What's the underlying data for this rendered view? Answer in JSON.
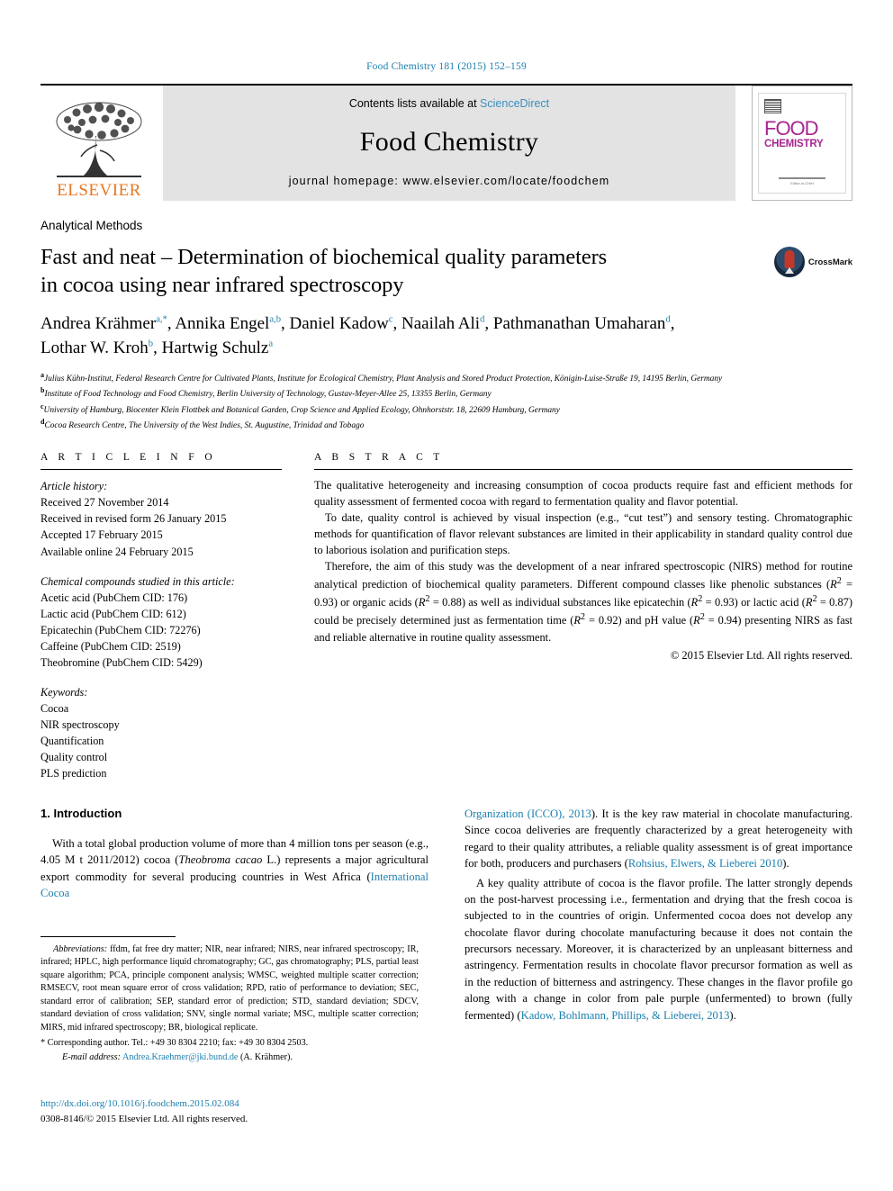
{
  "running_head": "Food Chemistry 181 (2015) 152–159",
  "masthead": {
    "publisher": "ELSEVIER",
    "contents_prefix": "Contents lists available at ",
    "contents_link": "ScienceDirect",
    "journal_name": "Food Chemistry",
    "homepage": "journal homepage: www.elsevier.com/locate/foodchem",
    "cover": {
      "line1": "FOOD",
      "line2": "CHEMISTRY",
      "footer": "Editor-in-Chief"
    }
  },
  "article": {
    "section_label": "Analytical Methods",
    "title_line1": "Fast and neat – Determination of biochemical quality parameters",
    "title_line2": "in cocoa using near infrared spectroscopy",
    "crossmark_label": "CrossMark",
    "authors_line1_parts": [
      {
        "name": "Andrea Krähmer",
        "sup": "a,*"
      },
      {
        "name": "Annika Engel",
        "sup": "a,b"
      },
      {
        "name": "Daniel Kadow",
        "sup": "c"
      },
      {
        "name": "Naailah Ali",
        "sup": "d"
      },
      {
        "name": "Pathmanathan Umaharan",
        "sup": "d"
      }
    ],
    "authors_line2_parts": [
      {
        "name": "Lothar W. Kroh",
        "sup": "b"
      },
      {
        "name": "Hartwig Schulz",
        "sup": "a"
      }
    ],
    "affiliations": [
      {
        "key": "a",
        "text": "Julius Kühn-Institut, Federal Research Centre for Cultivated Plants, Institute for Ecological Chemistry, Plant Analysis and Stored Product Protection, Königin-Luise-Straße 19, 14195 Berlin, Germany"
      },
      {
        "key": "b",
        "text": "Institute of Food Technology and Food Chemistry, Berlin University of Technology, Gustav-Meyer-Allee 25, 13355 Berlin, Germany"
      },
      {
        "key": "c",
        "text": "University of Hamburg, Biocenter Klein Flottbek and Botanical Garden, Crop Science and Applied Ecology, Ohnhorststr. 18, 22609 Hamburg, Germany"
      },
      {
        "key": "d",
        "text": "Cocoa Research Centre, The University of the West Indies, St. Augustine, Trinidad and Tobago"
      }
    ]
  },
  "article_info": {
    "heading": "A R T I C L E   I N F O",
    "history_label": "Article history:",
    "history": [
      "Received 27 November 2014",
      "Received in revised form 26 January 2015",
      "Accepted 17 February 2015",
      "Available online 24 February 2015"
    ],
    "compounds_label": "Chemical compounds studied in this article:",
    "compounds": [
      "Acetic acid (PubChem CID: 176)",
      "Lactic acid (PubChem CID: 612)",
      "Epicatechin (PubChem CID: 72276)",
      "Caffeine (PubChem CID: 2519)",
      "Theobromine (PubChem CID: 5429)"
    ],
    "keywords_label": "Keywords:",
    "keywords": [
      "Cocoa",
      "NIR spectroscopy",
      "Quantification",
      "Quality control",
      "PLS prediction"
    ]
  },
  "abstract": {
    "heading": "A B S T R A C T",
    "p1": "The qualitative heterogeneity and increasing consumption of cocoa products require fast and efficient methods for quality assessment of fermented cocoa with regard to fermentation quality and flavor potential.",
    "p2": "To date, quality control is achieved by visual inspection (e.g., “cut test”) and sensory testing. Chromatographic methods for quantification of flavor relevant substances are limited in their applicability in standard quality control due to laborious isolation and purification steps.",
    "p3_a": "Therefore, the aim of this study was the development of a near infrared spectroscopic (NIRS) method for routine analytical prediction of biochemical quality parameters. Different compound classes like phenolic substances (",
    "p3_r1": "R",
    "p3_r1v": " = 0.93",
    "p3_b": ") or organic acids (",
    "p3_r2v": " = 0.88",
    "p3_c": ") as well as individual substances like epicatechin (",
    "p3_r3v": " = 0.93",
    "p3_d": ") or lactic acid (",
    "p3_r4v": " = 0.87",
    "p3_e": ") could be precisely determined just as fermentation time (",
    "p3_r5v": " = 0.92",
    "p3_f": ") and pH value (",
    "p3_r6v": " = 0.94",
    "p3_g": ") presenting NIRS as fast and reliable alternative in routine quality assessment.",
    "copyright": "© 2015 Elsevier Ltd. All rights reserved."
  },
  "introduction": {
    "heading": "1. Introduction",
    "left_p1_a": "With a total global production volume of more than 4 million tons per season (e.g., 4.05 M t 2011/2012) cocoa (",
    "left_p1_it": "Theobroma cacao",
    "left_p1_b": " L.) represents a major agricultural export commodity for several producing countries in West Africa (",
    "left_ref1": "International Cocoa",
    "right_ref1_cont": "Organization (ICCO), 2013",
    "right_p1_a": "). It is the key raw material in chocolate manufacturing. Since cocoa deliveries are frequently characterized by a great heterogeneity with regard to their quality attributes, a reliable quality assessment is of great importance for both, producers and purchasers (",
    "right_ref2": "Rohsius, Elwers, & Lieberei 2010",
    "right_p1_b": ").",
    "right_p2_a": "A key quality attribute of cocoa is the flavor profile. The latter strongly depends on the post-harvest processing i.e., fermentation and drying that the fresh cocoa is subjected to in the countries of origin. Unfermented cocoa does not develop any chocolate flavor during chocolate manufacturing because it does not contain the precursors necessary. Moreover, it is characterized by an unpleasant bitterness and astringency. Fermentation results in chocolate flavor precursor formation as well as in the reduction of bitterness and astringency. These changes in the flavor profile go along with a change in color from pale purple (unfermented) to brown (fully fermented) (",
    "right_ref3": "Kadow, Bohlmann, Phillips, & Lieberei, 2013",
    "right_p2_b": ")."
  },
  "footnotes": {
    "abbr_label": "Abbreviations:",
    "abbr_text": " ffdm, fat free dry matter; NIR, near infrared; NIRS, near infrared spectroscopy; IR, infrared; HPLC, high performance liquid chromatography; GC, gas chromatography; PLS, partial least square algorithm; PCA, principle component analysis; WMSC, weighted multiple scatter correction; RMSECV, root mean square error of cross validation; RPD, ratio of performance to deviation; SEC, standard error of calibration; SEP, standard error of prediction; STD, standard deviation; SDCV, standard deviation of cross validation; SNV, single normal variate; MSC, multiple scatter correction; MIRS, mid infrared spectroscopy; BR, biological replicate.",
    "corresponding": "* Corresponding author. Tel.: +49 30 8304 2210; fax: +49 30 8304 2503.",
    "email_label": "E-mail address:",
    "email": "Andrea.Kraehmer@jki.bund.de",
    "email_suffix": " (A. Krähmer)."
  },
  "page_footer": {
    "doi": "http://dx.doi.org/10.1016/j.foodchem.2015.02.084",
    "issn": "0308-8146/© 2015 Elsevier Ltd. All rights reserved."
  },
  "colors": {
    "link": "#1a7fad",
    "elsevier_orange": "#E87722",
    "cover_magenta": "#a7258f",
    "masthead_grey": "#e3e3e3"
  }
}
